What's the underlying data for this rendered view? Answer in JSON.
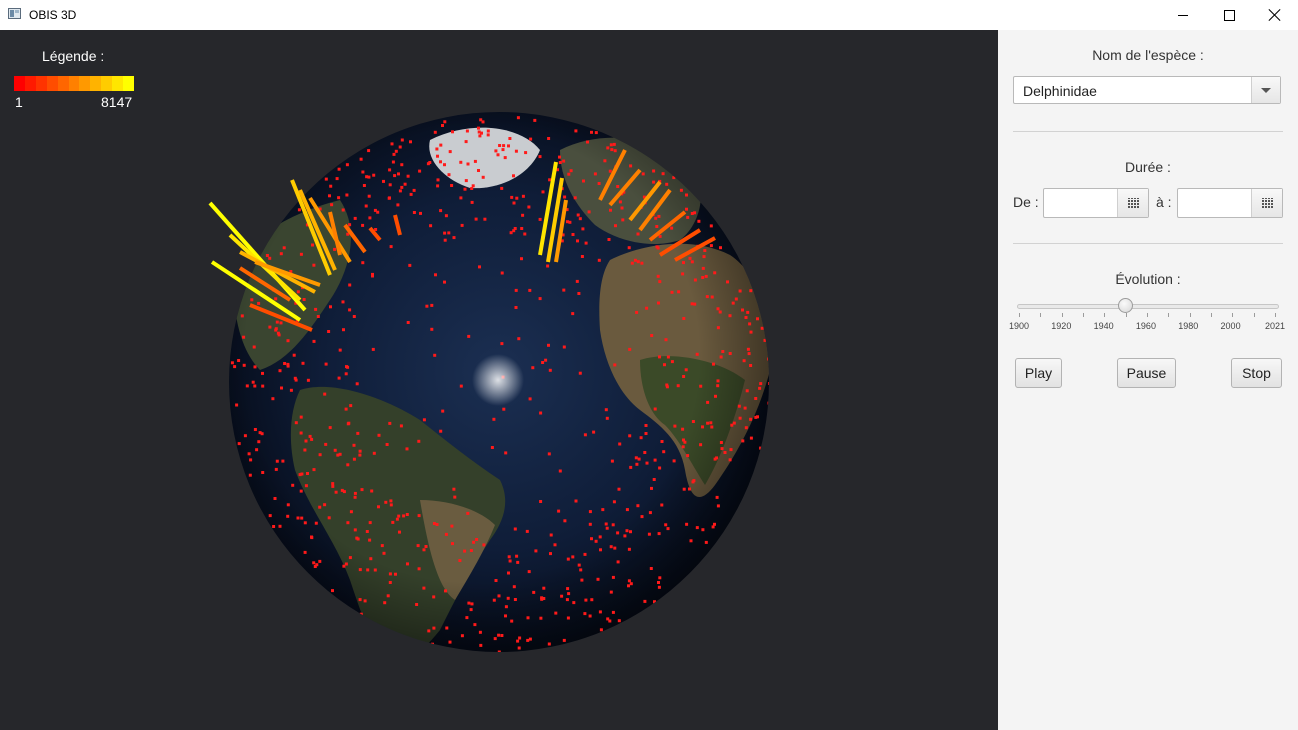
{
  "window": {
    "title": "OBIS 3D",
    "icon": "app-window-icon",
    "controls": [
      "minimize-icon",
      "maximize-icon",
      "close-icon"
    ]
  },
  "legend": {
    "title": "Légende :",
    "min": "1",
    "max": "8147",
    "gradient": [
      "#ff0000",
      "#ff1a00",
      "#ff3300",
      "#ff4d00",
      "#ff6600",
      "#ff8000",
      "#ff9900",
      "#ffb300",
      "#ffcc00",
      "#ffe600",
      "#ffff00"
    ]
  },
  "panel": {
    "species_label": "Nom de l'espèce :",
    "species_value": "Delphinidae",
    "duration_label": "Durée :",
    "from_label": "De :",
    "to_label": "à :",
    "from_value": "",
    "to_value": "",
    "evolution_label": "Évolution :",
    "slider": {
      "min": 1900,
      "max": 2021,
      "value": 1950,
      "tick_labels": [
        "1900",
        "1920",
        "1940",
        "1960",
        "1980",
        "2000",
        "2021"
      ]
    },
    "buttons": {
      "play": "Play",
      "pause": "Pause",
      "stop": "Stop"
    }
  },
  "colors": {
    "viewport_bg": "#26272b",
    "panel_bg": "#f4f4f4",
    "ocean": "#0d1a33",
    "land": "#3a4a2c",
    "marker": "#ff1a1a"
  }
}
